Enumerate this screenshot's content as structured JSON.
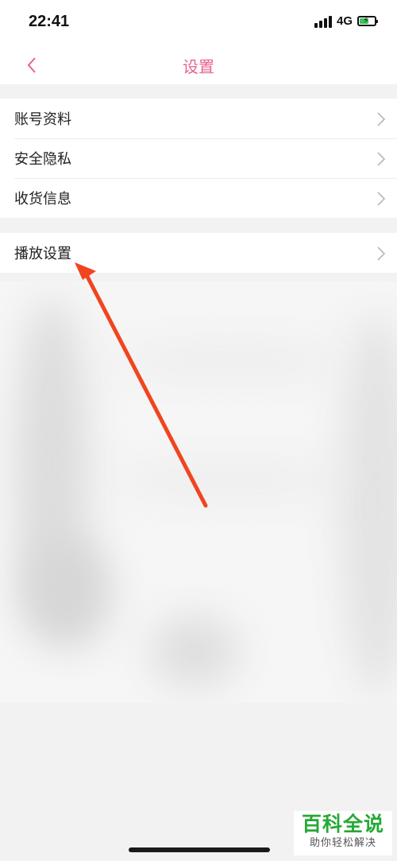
{
  "status_bar": {
    "time": "22:41",
    "network": "4G",
    "battery_level": 0.6
  },
  "nav": {
    "title": "设置",
    "back_icon": "chevron-left-icon"
  },
  "groups": [
    {
      "items": [
        {
          "label": "账号资料"
        },
        {
          "label": "安全隐私"
        },
        {
          "label": "收货信息"
        }
      ]
    },
    {
      "items": [
        {
          "label": "播放设置"
        }
      ]
    }
  ],
  "colors": {
    "accent": "#e8628f",
    "annotation_arrow": "#f0451f",
    "watermark_green": "#25a934"
  },
  "watermark": {
    "title": "百科全说",
    "subtitle": "助你轻松解决"
  }
}
